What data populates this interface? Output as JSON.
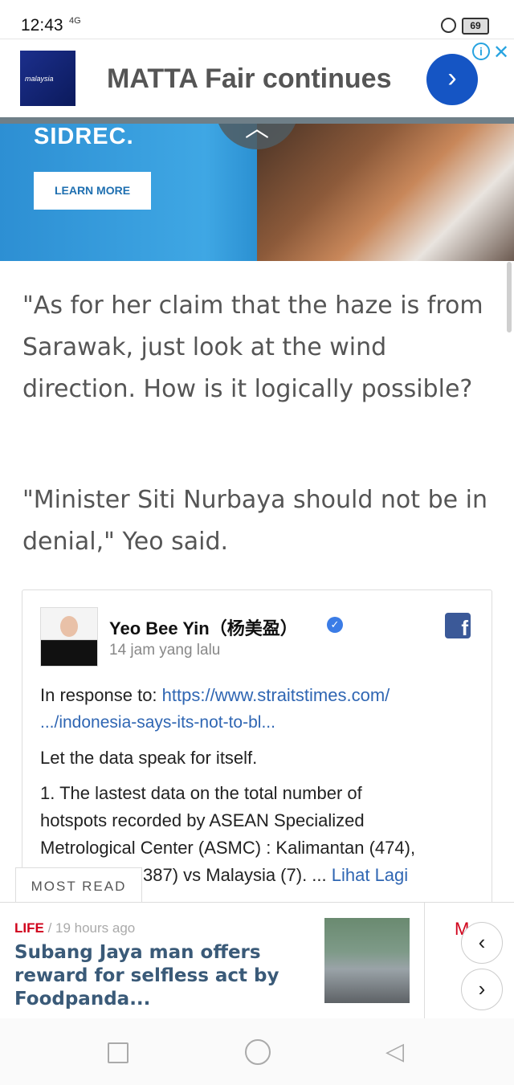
{
  "status_bar": {
    "time": "12:43",
    "network": "4G",
    "battery": "69"
  },
  "ad": {
    "brand": "malaysia",
    "title": "MATTA Fair continues"
  },
  "hero": {
    "heading": "SIDREC.",
    "cta": "LEARN MORE"
  },
  "article": {
    "paragraphs": [
      "\"As for her claim that the haze is from Sarawak, just look at the wind direction. How is it logically possible?",
      "\"Minister Siti Nurbaya should not be in denial,\" Yeo said."
    ]
  },
  "embed": {
    "author": "Yeo Bee Yin（杨美盈）",
    "time": "14 jam yang lalu",
    "response_prefix": "In response to: ",
    "link_line1": "https://www.straitstimes.com/",
    "link_line2": ".../indonesia-says-its-not-to-bl...",
    "line1": "Let the data speak for itself.",
    "line2": "1. The lastest data on the total number of",
    "line3": "hotspots recorded by ASEAN Specialized",
    "line4": "Metrological Center (ASMC) : Kalimantan (474),",
    "line5": "387) vs Malaysia (7). ... ",
    "more": "Lihat Lagi"
  },
  "most_read": {
    "tab": "MOST READ",
    "category": "LIFE",
    "age": " / 19 hours ago",
    "headline": "Subang Jaya man offers reward for selfless act by Foodpanda...",
    "peek": "M"
  }
}
